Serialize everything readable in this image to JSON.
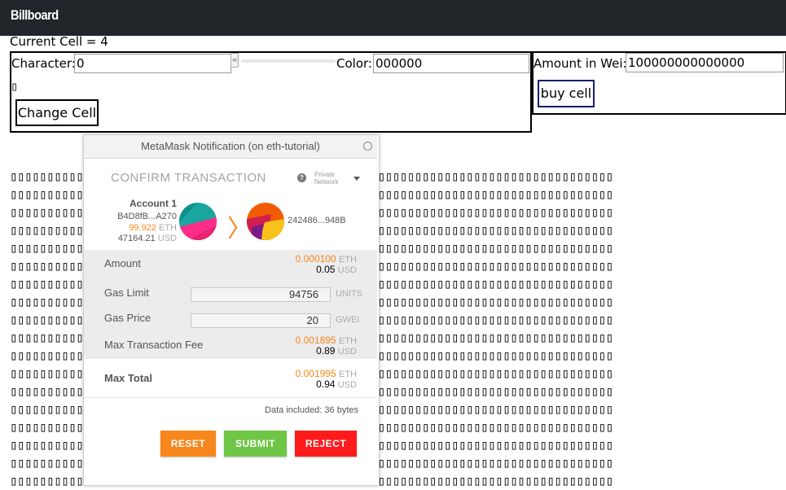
{
  "app": {
    "brand": "Billboard"
  },
  "status": {
    "current_cell": "Current Cell = 4"
  },
  "edit_form": {
    "character_label": "Character:",
    "character_value": "0",
    "color_label": "Color:",
    "color_value": "000000",
    "change_button": "Change Cell",
    "stray_glyph": "▯"
  },
  "buy_form": {
    "amount_label": "Amount in Wei:",
    "amount_value": "100000000000000",
    "buy_button": "buy cell"
  },
  "grid": {
    "row_text": "▯▯▯▯▯▯▯▯▯▯▯▯▯▯▯▯▯▯▯▯▯▯▯▯▯▯▯▯▯▯▯▯▯▯▯▯▯▯▯▯▯▯▯▯▯▯▯▯▯▯▯▯▯▯▯▯▯▯▯▯▯▯▯▯▯▯▯▯▯▯▯▯▯▯▯▯▯▯▯▯▯▯",
    "rows": 18
  },
  "metamask": {
    "title": "MetaMask Notification (on eth-tutorial)",
    "confirm_heading": "CONFIRM TRANSACTION",
    "network_line1": "Private",
    "network_line2": "Network",
    "account": {
      "name": "Account 1",
      "address": "B4D8fB...A270",
      "eth_balance": "99.922",
      "eth_unit": "ETH",
      "usd_balance": "47164.21",
      "usd_unit": "USD"
    },
    "recipient": "242486...948B",
    "amount": {
      "label": "Amount",
      "eth": "0.000100",
      "eth_unit": "ETH",
      "usd": "0.05",
      "usd_unit": "USD"
    },
    "gas_limit": {
      "label": "Gas Limit",
      "value": "94756",
      "unit": "UNITS"
    },
    "gas_price": {
      "label": "Gas Price",
      "value": "20",
      "unit": "GWEI"
    },
    "max_fee": {
      "label": "Max Transaction Fee",
      "eth": "0.001895",
      "eth_unit": "ETH",
      "usd": "0.89",
      "usd_unit": "USD"
    },
    "max_total": {
      "label": "Max Total",
      "eth": "0.001995",
      "eth_unit": "ETH",
      "usd": "0.94",
      "usd_unit": "USD"
    },
    "data_included": "Data included: 36 bytes",
    "buttons": {
      "reset": "RESET",
      "submit": "SUBMIT",
      "reject": "REJECT"
    },
    "colors": {
      "accent": "#f7861c",
      "reset": "#f7861c",
      "submit": "#6fc646",
      "reject": "#ff1b1b"
    }
  }
}
